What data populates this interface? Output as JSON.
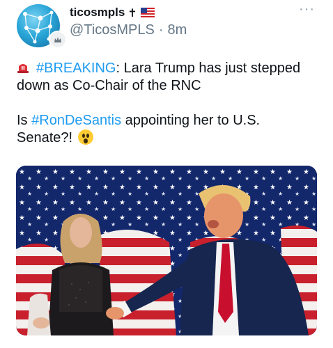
{
  "tweet": {
    "display_name": "ticosmpls",
    "name_symbol": "✝",
    "handle": "@TicosMPLS",
    "separator": "·",
    "time": "8m",
    "text_line1_hashtag": "#BREAKING",
    "text_line1_rest": ": Lara Trump has just stepped",
    "text_line2": "down as Co-Chair of the RNC",
    "text_line3_prefix": "Is ",
    "text_line3_hashtag": "#RonDeSantis",
    "text_line3_rest": " appointing her to U.S.",
    "text_line4": "Senate?! ",
    "more_label": "···"
  },
  "icons": {
    "siren": "police-siren-icon",
    "flag": "us-flag-icon",
    "surprised": "surprised-face-icon",
    "more": "more-options-icon"
  },
  "colors": {
    "hashtag": "#1d9bf0",
    "secondary_text": "#657786",
    "background": "#ffffff"
  }
}
